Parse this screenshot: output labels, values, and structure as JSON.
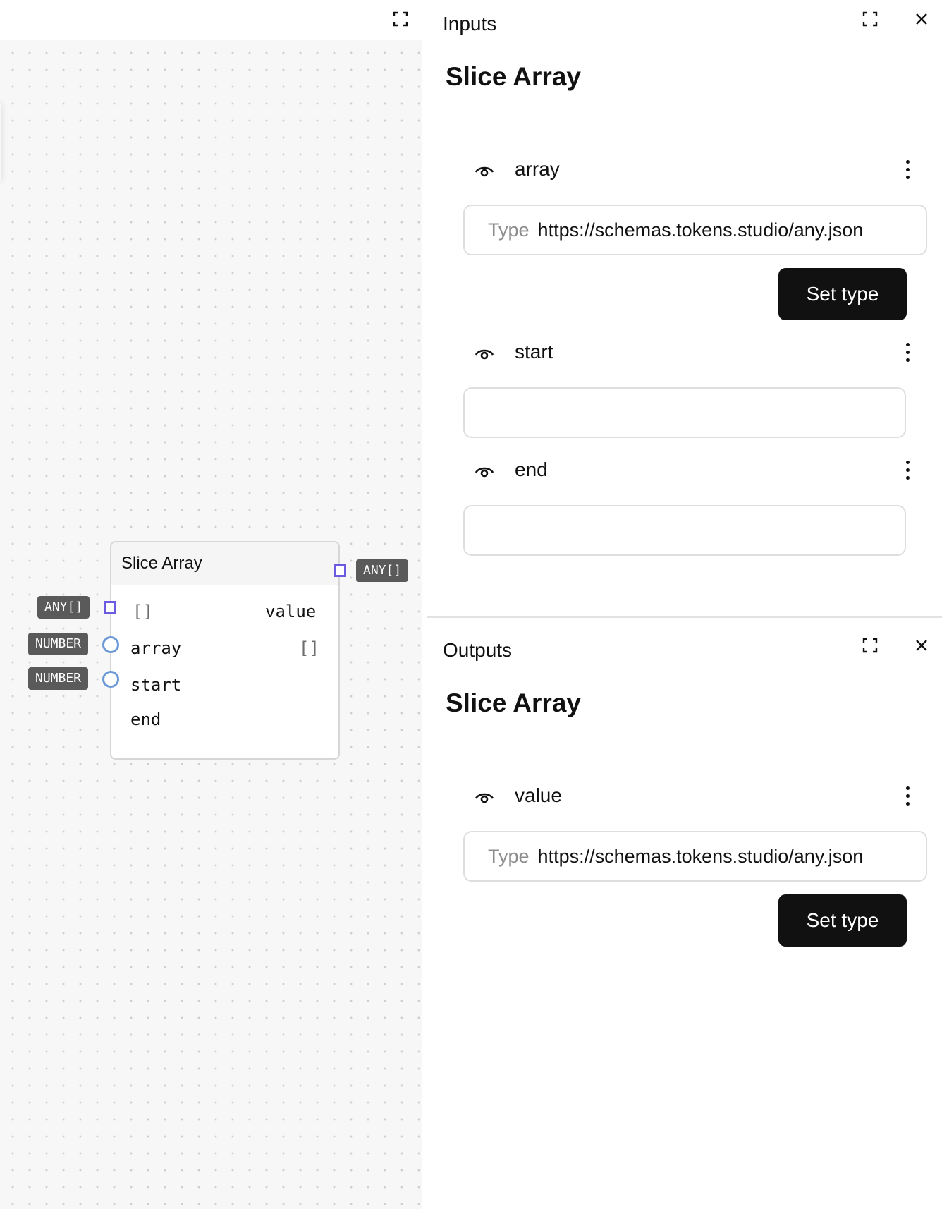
{
  "canvas": {
    "node": {
      "title": "Slice Array",
      "output_port": {
        "default": "[]",
        "label": "value",
        "type": "ANY[]"
      },
      "input_ports": [
        {
          "label": "array",
          "type": "ANY[]",
          "value": "[]"
        },
        {
          "label": "start",
          "type": "NUMBER"
        },
        {
          "label": "end",
          "type": "NUMBER"
        }
      ]
    }
  },
  "inputs_panel": {
    "title": "Inputs",
    "heading": "Slice Array",
    "ports": [
      {
        "label": "array",
        "type_prefix": "Type",
        "type_value": "https://schemas.tokens.studio/any.json",
        "button": "Set type"
      },
      {
        "label": "start",
        "value": ""
      },
      {
        "label": "end",
        "value": ""
      }
    ]
  },
  "outputs_panel": {
    "title": "Outputs",
    "heading": "Slice Array",
    "ports": [
      {
        "label": "value",
        "type_prefix": "Type",
        "type_value": "https://schemas.tokens.studio/any.json",
        "button": "Set type"
      }
    ]
  },
  "colors": {
    "array_handle": "#6b5be0",
    "number_handle": "#6b98d6",
    "badge_bg": "#5a5a5a",
    "button_bg": "#111111"
  },
  "icons": [
    "expand-icon",
    "close-icon",
    "eye-icon",
    "kebab-menu-icon"
  ]
}
